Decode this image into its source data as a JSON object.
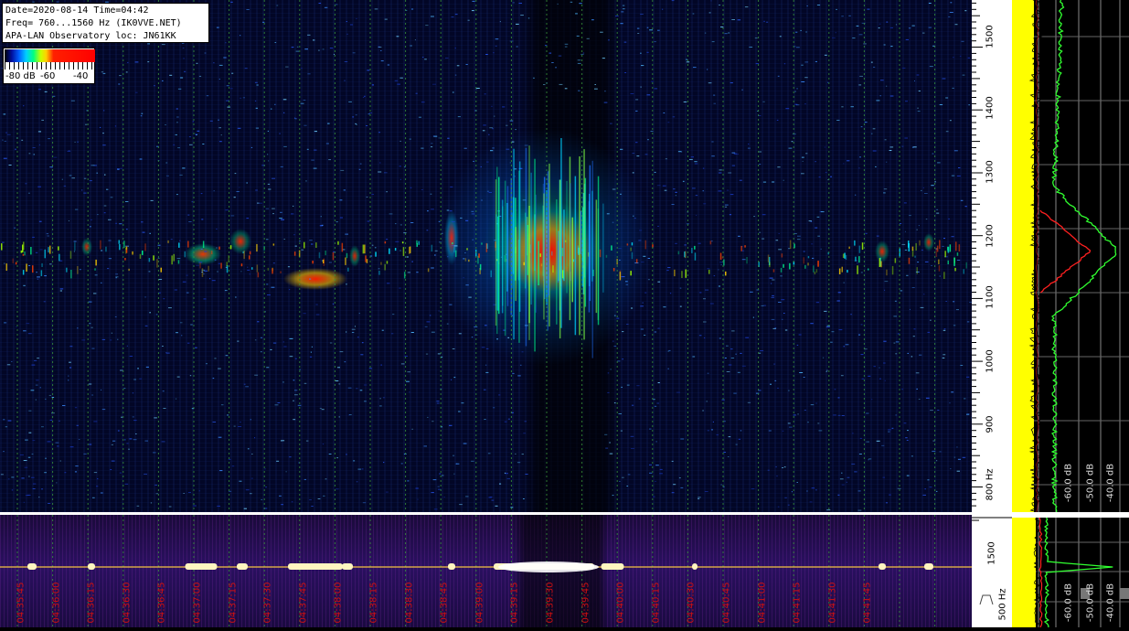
{
  "info": {
    "line1": "Date=2020-08-14 Time=04:42",
    "line2": "Freq= 760...1560 Hz (IK0VVE.NET)",
    "line3": "APA-LAN Observatory loc: JN61KK"
  },
  "legend": {
    "labels": [
      "-80 dB",
      "-60",
      "-40"
    ]
  },
  "freq_axis": {
    "labels": [
      "1500",
      "1400",
      "1300",
      "1200",
      "1100",
      "1000",
      "900",
      "800 Hz"
    ],
    "values": [
      1500,
      1400,
      1300,
      1200,
      1100,
      1000,
      900,
      800
    ],
    "range_hz": [
      760,
      1575
    ]
  },
  "spectrum_db_labels": [
    "-60.0 dB",
    "-50.0 dB",
    "-40.0 dB"
  ],
  "strip_freq_labels": [
    "1500",
    "500 Hz"
  ],
  "strip_db_labels": [
    "-60.0 dB",
    "-50.0 dB",
    "-40.0 dB"
  ],
  "time_labels": [
    "04:35:45",
    "04:36:00",
    "04:36:15",
    "04:36:30",
    "04:36:45",
    "04:37:00",
    "04:37:15",
    "04:37:30",
    "04:37:45",
    "04:38:00",
    "04:38:15",
    "04:38:30",
    "04:38:45",
    "04:39:00",
    "04:39:15",
    "04:39:30",
    "04:39:45",
    "04:40:00",
    "04:40:15",
    "04:40:30",
    "04:40:45",
    "04:41:00",
    "04:41:15",
    "04:41:30",
    "04:41:45"
  ],
  "colors": {
    "grid": "#3a9a3a",
    "time_label": "#d01010",
    "avg_trace": "#ffff00",
    "peak_trace": "#30ff30",
    "mean_trace": "#ff2020"
  }
}
